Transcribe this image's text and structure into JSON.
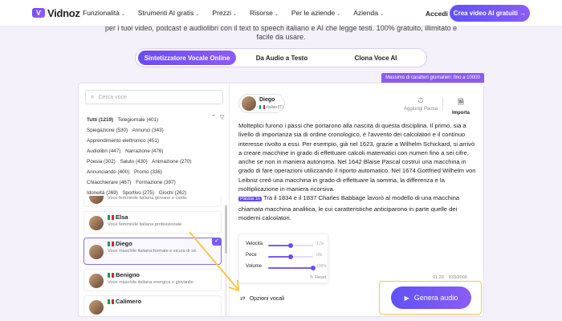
{
  "nav": {
    "logo_text": "Vidnoz",
    "logo_glyph": "V",
    "items": [
      {
        "label": "Funzionalità"
      },
      {
        "label": "Strumenti AI gratis"
      },
      {
        "label": "Prezzi"
      },
      {
        "label": "Risorse"
      },
      {
        "label": "Per le aziende"
      },
      {
        "label": "Azienda"
      }
    ],
    "login": "Accedi",
    "cta": "Crea video AI gratuiti →"
  },
  "subtitle_line1": "per i tuoi video, podcast e audiolibri con il text to speech italiano e AI che legge testi. 100% gratuito, illimitato e",
  "subtitle_line2": "facile da usare.",
  "tabs": [
    "Sintetizzatore Vocale Online",
    "Da Audio a Testo",
    "Clona Voce AI"
  ],
  "banner": "Massimo di caratteri giornalieri: fino a 10000",
  "search_placeholder": "Cerca voce",
  "categories": [
    "Tutti (1219)",
    "Telegiornale (401)",
    "Spiegazione (530)",
    "Annunci (343)",
    "Apprendimento elettronico (451)",
    "Audiolibri (447)",
    "Narrazione (476)",
    "Poesia (302)",
    "Saluto (430)",
    "Animazione (270)",
    "Annunciando (400)",
    "Promo (336)",
    "Chiacchierare (467)",
    "Formazione (397)",
    "Idoneità (269)",
    "Sportivo (275)",
    "Giochi (262)"
  ],
  "voices": [
    {
      "name": "",
      "desc": "Voce femminile italiana giovane e calda.",
      "selected": false
    },
    {
      "name": "Elsa",
      "desc": "Voce femminile italiana professionale.",
      "selected": false
    },
    {
      "name": "Diego",
      "desc": "Voce maschile italiana formale e sicura di sé.",
      "selected": true
    },
    {
      "name": "Benigno",
      "desc": "Voce maschile italiana energica e giovanile.",
      "selected": false
    },
    {
      "name": "Calimero",
      "desc": "",
      "selected": false
    }
  ],
  "speaker": {
    "name": "Diego",
    "lang": "Italian(IT)"
  },
  "tools": {
    "pause": "Aggiungi Pausa",
    "import": "Importa"
  },
  "text_part1": "Molteplici furono i passi che portarono alla nascita di questa disciplina. Il primo, sia a livello di importanza sia di ordine cronologico, è l'avvento dei calcolatori e il continuo interesse rivolto a essi. Per esempio, già nel 1623, grazie a Wilhelm Schickard, si arrivò a creare macchine in grado di effettuare calcoli matematici con numeri fino a sei cifre, anche se non in maniera autonoma. Nel 1642 Blaise Pascal costruì una macchina in grado di fare operazioni utilizzando il riporto automatico. Nel 1674 Gottfried Wilhelm von Leibniz creò una macchina in grado di effettuare la somma, la differenza e la moltiplicazione in maniera ricorsiva.",
  "pause_tag": "Pausa 1s",
  "text_part2": "Tra il 1834 e il 1837 Charles Babbage lavorò al modello di una macchina chiamata macchina analitica, le cui caratteristiche anticiparono in parte quelle dei moderni calcolatori.",
  "settings": [
    {
      "label": "Velocità",
      "value": "1.0x",
      "level": 0.5
    },
    {
      "label": "Pece",
      "value": "0%",
      "level": 0.5
    },
    {
      "label": "Volume",
      "value": "100%",
      "level": 1.0
    }
  ],
  "reset": "Reset",
  "options_label": "Opzioni vocali",
  "counter_time": "01:20",
  "counter_chars": "833/2000",
  "generate": "Genera audio",
  "colors": {
    "accent": "#6a4cf5",
    "highlight": "#f5c84a"
  }
}
